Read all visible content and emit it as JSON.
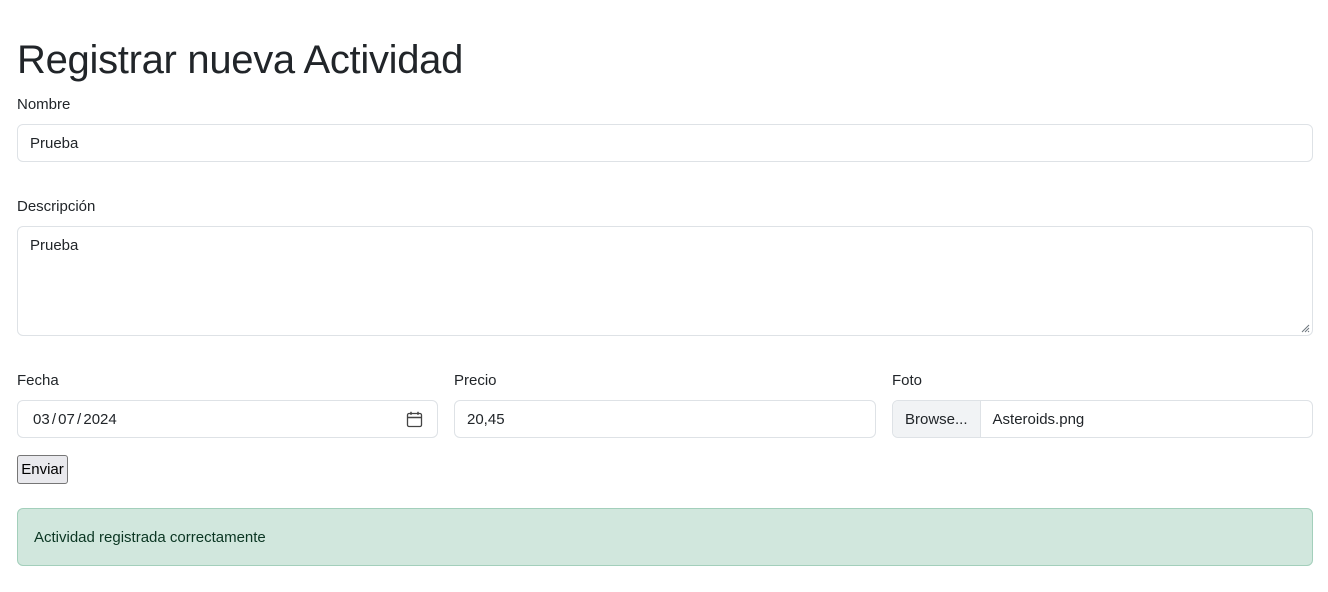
{
  "page": {
    "title": "Registrar nueva Actividad"
  },
  "form": {
    "nombre": {
      "label": "Nombre",
      "value": "Prueba"
    },
    "descripcion": {
      "label": "Descripción",
      "value": "Prueba"
    },
    "fecha": {
      "label": "Fecha",
      "value": "03 / 07 / 2024",
      "icon": "calendar-icon"
    },
    "precio": {
      "label": "Precio",
      "value": "20,45"
    },
    "foto": {
      "label": "Foto",
      "browse_label": "Browse...",
      "file_name": "Asteroids.png"
    },
    "submit_label": "Enviar"
  },
  "alert": {
    "message": "Actividad registrada correctamente",
    "type": "success",
    "background": "#d1e7dd",
    "border": "#a3cfbb",
    "text_color": "#0a3622"
  }
}
